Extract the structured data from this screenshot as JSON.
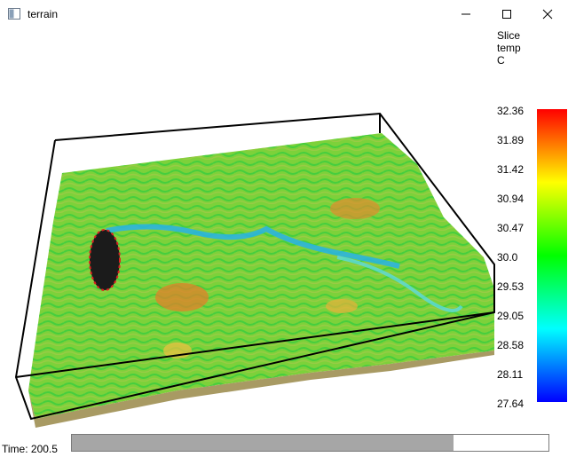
{
  "window": {
    "title": "terrain"
  },
  "slice": {
    "label_line1": "Slice",
    "label_line2": "temp",
    "label_line3": "C"
  },
  "colorbar": {
    "ticks": [
      "32.36",
      "31.89",
      "31.42",
      "30.94",
      "30.47",
      "30.0",
      "29.53",
      "29.05",
      "28.58",
      "28.11",
      "27.64"
    ],
    "colors": [
      "#ff0000",
      "#ffff00",
      "#00ff00",
      "#00ffff",
      "#0000ff"
    ]
  },
  "status": {
    "time_text": "Time: 200.5"
  },
  "progress": {
    "fraction": 0.8
  },
  "icons": {
    "minimize": "minimize-icon",
    "maximize": "maximize-icon",
    "close": "close-icon"
  }
}
